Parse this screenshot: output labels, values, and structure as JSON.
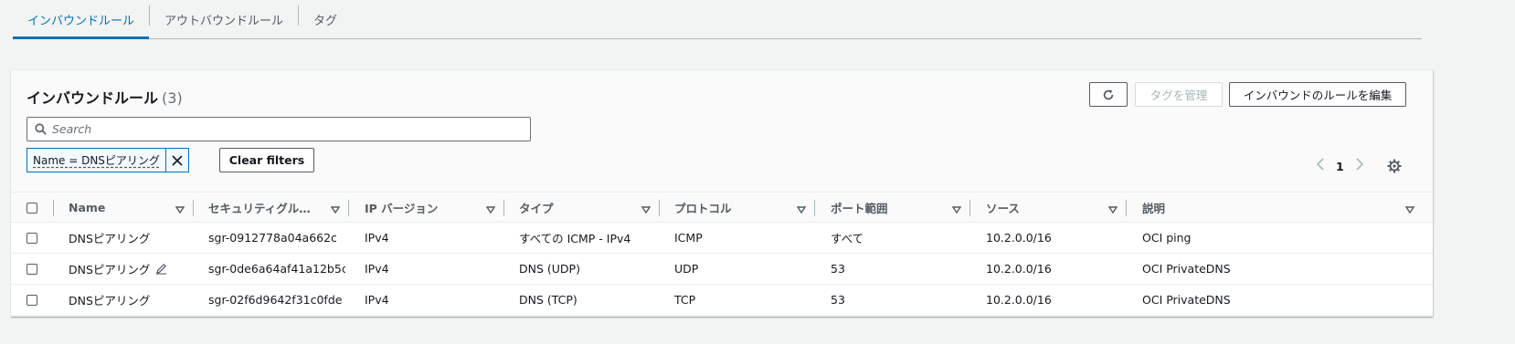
{
  "tabs": [
    {
      "label": "インバウンドルール",
      "active": true
    },
    {
      "label": "アウトバウンドルール",
      "active": false
    },
    {
      "label": "タグ",
      "active": false
    }
  ],
  "panel": {
    "title": "インバウンドルール",
    "count": "(3)",
    "manage_tags_label": "タグを管理",
    "edit_rules_label": "インバウンドのルールを編集",
    "search_placeholder": "Search",
    "filter_token": "Name = DNSピアリング",
    "clear_filters_label": "Clear filters",
    "page_number": "1"
  },
  "columns": [
    "Name",
    "セキュリティグルー...",
    "IP バージョン",
    "タイプ",
    "プロトコル",
    "ポート範囲",
    "ソース",
    "説明"
  ],
  "rows": [
    {
      "name": "DNSピアリング",
      "sgr": "sgr-0912778a04a662c...",
      "ip": "IPv4",
      "type": "すべての ICMP - IPv4",
      "protocol": "ICMP",
      "port": "すべて",
      "source": "10.2.0.0/16",
      "desc": "OCI ping"
    },
    {
      "name": "DNSピアリング",
      "sgr": "sgr-0de6a64af41a12b5c",
      "ip": "IPv4",
      "type": "DNS (UDP)",
      "protocol": "UDP",
      "port": "53",
      "source": "10.2.0.0/16",
      "desc": "OCI PrivateDNS"
    },
    {
      "name": "DNSピアリング",
      "sgr": "sgr-02f6d9642f31c0fde",
      "ip": "IPv4",
      "type": "DNS (TCP)",
      "protocol": "TCP",
      "port": "53",
      "source": "10.2.0.0/16",
      "desc": "OCI PrivateDNS"
    }
  ],
  "icons": {
    "refresh": "refresh-icon",
    "search": "search-icon",
    "close": "close-icon",
    "prev": "chevron-left-icon",
    "next": "chevron-right-icon",
    "settings": "gear-icon",
    "sort": "sort-down-icon",
    "edit": "pencil-icon"
  },
  "colors": {
    "accent": "#0073bb",
    "text": "#16191f",
    "muted": "#545b64",
    "background": "#f2f3f3"
  }
}
